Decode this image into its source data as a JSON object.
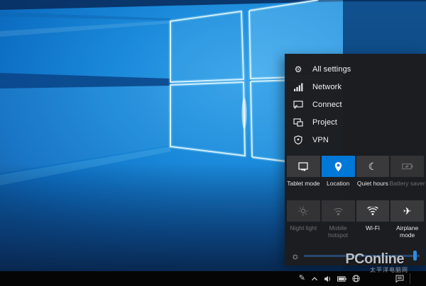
{
  "colors": {
    "accent": "#0078d7",
    "panel_bg": "#1d1d1f",
    "tile_bg": "#3a3a3c",
    "taskbar_bg": "#050506",
    "wallpaper_bright": "#2f9ce6",
    "wallpaper_dark": "#0a2c58"
  },
  "action_center": {
    "menu_items": [
      {
        "label": "All settings",
        "icon": "gear-icon",
        "glyph": "⚙"
      },
      {
        "label": "Network",
        "icon": "network-signal-icon"
      },
      {
        "label": "Connect",
        "icon": "connect-icon"
      },
      {
        "label": "Project",
        "icon": "project-icon"
      },
      {
        "label": "VPN",
        "icon": "vpn-icon"
      }
    ],
    "tiles": [
      {
        "label": "Tablet mode",
        "icon": "tablet-mode-icon",
        "state": "normal"
      },
      {
        "label": "Location",
        "icon": "location-icon",
        "state": "active"
      },
      {
        "label": "Quiet hours",
        "icon": "quiet-hours-icon",
        "state": "normal",
        "glyph": "☾"
      },
      {
        "label": "Battery saver",
        "icon": "battery-saver-icon",
        "state": "disabled"
      },
      {
        "label": "Night light",
        "icon": "night-light-icon",
        "state": "disabled"
      },
      {
        "label": "Mobile hotspot",
        "icon": "mobile-hotspot-icon",
        "state": "disabled"
      },
      {
        "label": "Wi-Fi",
        "icon": "wifi-icon",
        "state": "normal"
      },
      {
        "label": "Airplane mode",
        "icon": "airplane-mode-icon",
        "state": "normal",
        "glyph": "✈"
      }
    ],
    "brightness": {
      "icon": "brightness-sun-icon",
      "glyph": "☼",
      "value_percent": 97
    }
  },
  "taskbar": {
    "tray_icons": [
      {
        "name": "pen-icon",
        "glyph": "✎"
      },
      {
        "name": "hidden-icons-chevron-icon"
      },
      {
        "name": "volume-icon"
      },
      {
        "name": "battery-icon"
      },
      {
        "name": "network-tray-icon"
      },
      {
        "name": "action-center-icon"
      }
    ]
  },
  "watermark": {
    "line1": "PConline",
    "line2": "太平洋电脑网"
  }
}
